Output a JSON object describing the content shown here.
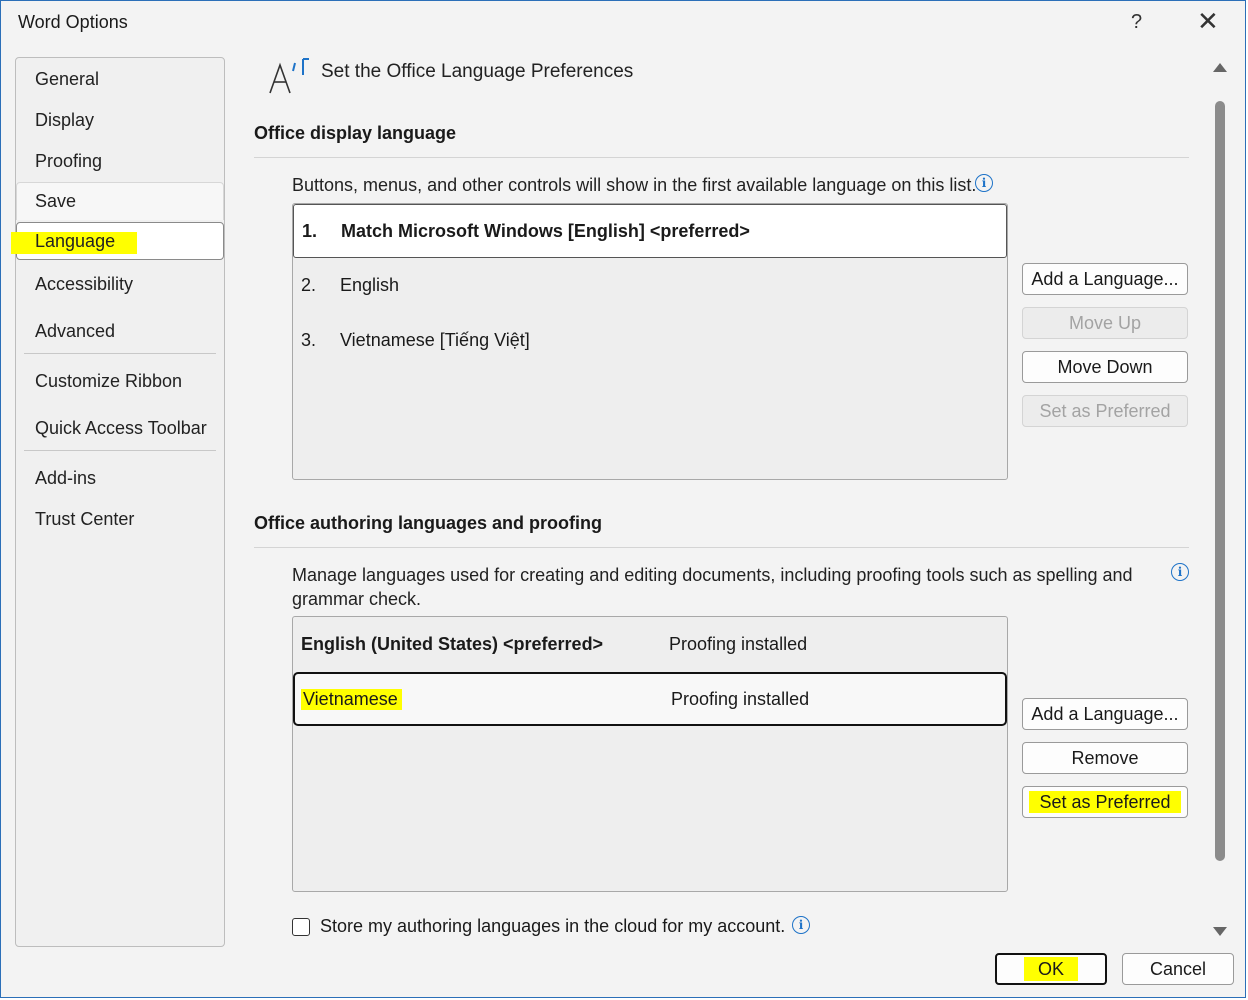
{
  "window": {
    "title": "Word Options",
    "help": "?",
    "close": "✕"
  },
  "sidebar": {
    "items": [
      {
        "label": "General"
      },
      {
        "label": "Display"
      },
      {
        "label": "Proofing"
      },
      {
        "label": "Save"
      },
      {
        "label": "Language"
      },
      {
        "label": "Accessibility"
      },
      {
        "label": "Advanced"
      },
      {
        "label": "Customize Ribbon"
      },
      {
        "label": "Quick Access Toolbar"
      },
      {
        "label": "Add-ins"
      },
      {
        "label": "Trust Center"
      }
    ],
    "selected": "Language"
  },
  "page": {
    "title": "Set the Office Language Preferences",
    "icon": "language-icon"
  },
  "display_section": {
    "title": "Office display language",
    "description": "Buttons, menus, and other controls will show in the first available language on this list.",
    "languages": [
      {
        "num": "1.",
        "name": "Match Microsoft Windows [English] <preferred>"
      },
      {
        "num": "2.",
        "name": "English"
      },
      {
        "num": "3.",
        "name": "Vietnamese [Tiếng Việt]"
      }
    ],
    "buttons": {
      "add": "Add a Language...",
      "move_up": "Move Up",
      "move_down": "Move Down",
      "set_preferred": "Set as Preferred"
    }
  },
  "authoring_section": {
    "title": "Office authoring languages and proofing",
    "description": "Manage languages used for creating and editing documents, including proofing tools such as spelling and grammar check.",
    "languages": [
      {
        "name": "English (United States) <preferred>",
        "status": "Proofing installed"
      },
      {
        "name": "Vietnamese",
        "status": "Proofing installed"
      }
    ],
    "buttons": {
      "add": "Add a Language...",
      "remove": "Remove",
      "set_preferred": "Set as Preferred"
    }
  },
  "cloud_checkbox": {
    "label": "Store my authoring languages in the cloud for my account.",
    "checked": false
  },
  "footer": {
    "ok": "OK",
    "cancel": "Cancel"
  },
  "colors": {
    "highlight": "#ffff00",
    "info_blue": "#1e73c8",
    "window_border": "#2b6fb8"
  }
}
